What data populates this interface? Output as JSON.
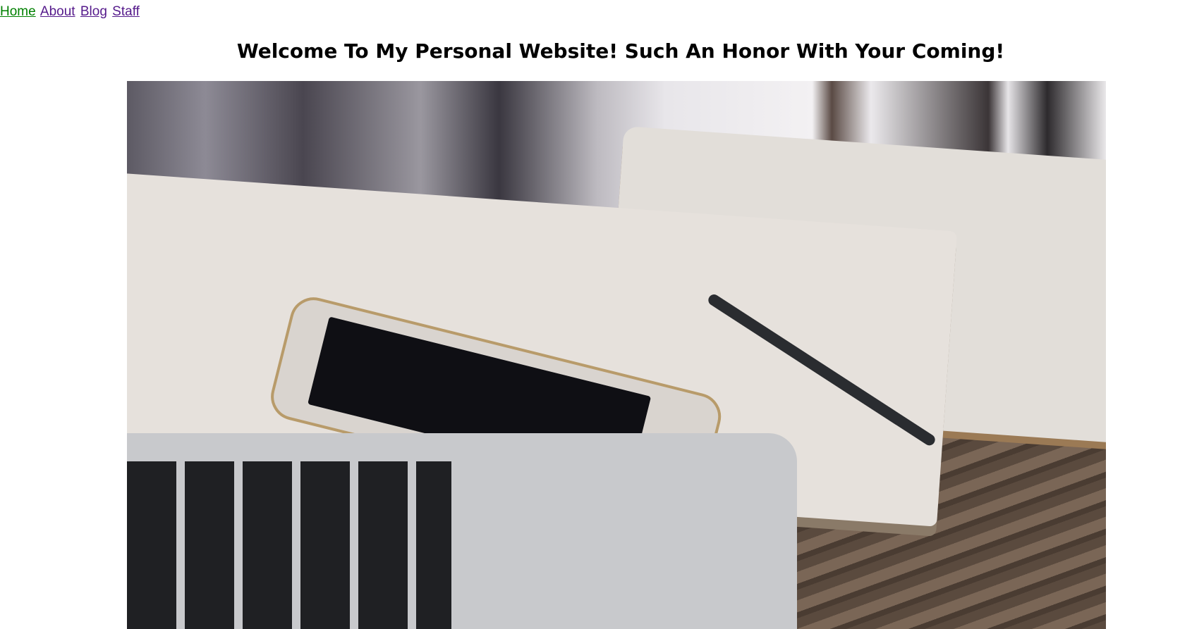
{
  "nav": {
    "links": [
      {
        "label": "Home"
      },
      {
        "label": "About"
      },
      {
        "label": "Blog"
      },
      {
        "label": "Staff"
      }
    ]
  },
  "header": {
    "title": "Welcome To My Personal Website! Such An Honor With Your Coming!"
  },
  "colors": {
    "home_link": "#008000",
    "visited_link": "#551a8b"
  }
}
